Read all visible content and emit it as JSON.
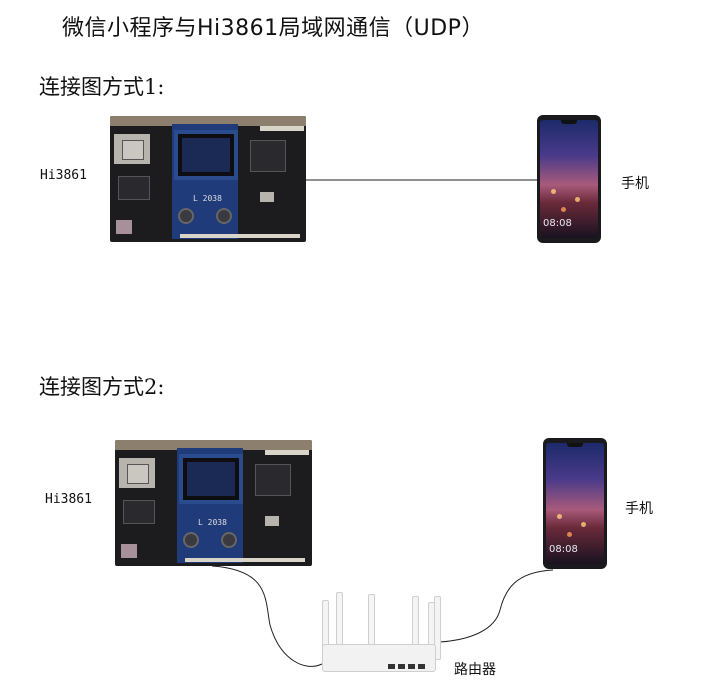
{
  "title": "微信小程序与Hi3861局域网通信（UDP）",
  "diagram1": {
    "heading": "连接图方式1:",
    "device_label": "Hi3861",
    "phone_label": "手机",
    "board_oled_text": "L 2038",
    "phone_time": "08:08"
  },
  "diagram2": {
    "heading": "连接图方式2:",
    "device_label": "Hi3861",
    "phone_label": "手机",
    "router_label": "路由器",
    "board_oled_text": "L 2038",
    "phone_time": "08:08"
  }
}
